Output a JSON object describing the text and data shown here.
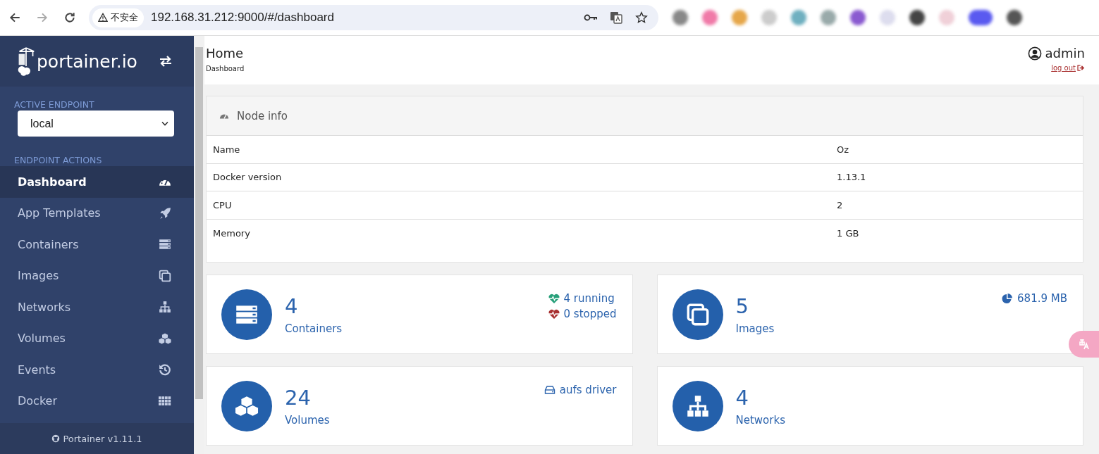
{
  "browser": {
    "security_label": "不安全",
    "url": "192.168.31.212:9000/#/dashboard"
  },
  "sidebar": {
    "logo_text": "portainer.io",
    "active_endpoint_label": "ACTIVE ENDPOINT",
    "endpoint": "local",
    "actions_label": "ENDPOINT ACTIONS",
    "items": [
      {
        "label": "Dashboard",
        "kind": "dashboard",
        "selected": true
      },
      {
        "label": "App Templates",
        "kind": "rocket",
        "selected": false
      },
      {
        "label": "Containers",
        "kind": "server",
        "selected": false
      },
      {
        "label": "Images",
        "kind": "clone",
        "selected": false
      },
      {
        "label": "Networks",
        "kind": "sitemap",
        "selected": false
      },
      {
        "label": "Volumes",
        "kind": "cubes",
        "selected": false
      },
      {
        "label": "Events",
        "kind": "history",
        "selected": false
      },
      {
        "label": "Docker",
        "kind": "grid",
        "selected": false
      }
    ],
    "footer": "Portainer v1.11.1"
  },
  "header": {
    "title": "Home",
    "subtitle": "Dashboard",
    "user": "admin",
    "logout": "log out"
  },
  "node_info": {
    "title": "Node info",
    "rows": [
      {
        "name": "Name",
        "value": "Oz"
      },
      {
        "name": "Docker version",
        "value": "1.13.1"
      },
      {
        "name": "CPU",
        "value": "2"
      },
      {
        "name": "Memory",
        "value": "1 GB"
      }
    ]
  },
  "widgets": [
    {
      "kind": "server",
      "count": "4",
      "label": "Containers",
      "stats": [
        {
          "kind": "running",
          "text": "4 running"
        },
        {
          "kind": "stopped",
          "text": "0 stopped"
        }
      ]
    },
    {
      "kind": "clone",
      "count": "5",
      "label": "Images",
      "stats": [
        {
          "kind": "size",
          "text": "681.9 MB"
        }
      ]
    },
    {
      "kind": "cubes",
      "count": "24",
      "label": "Volumes",
      "stats": [
        {
          "kind": "driver",
          "text": "aufs driver"
        }
      ]
    },
    {
      "kind": "sitemap",
      "count": "4",
      "label": "Networks"
    }
  ]
}
